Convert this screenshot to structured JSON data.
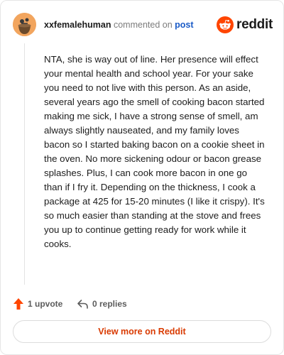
{
  "comment": {
    "username": "xxfemalehuman",
    "commented_text": "commented on",
    "post_link_text": "post",
    "body": "NTA, she is way out of line. Her presence will effect your mental health and school year. For your sake you need to not live with this person. As an aside, several years ago the smell of cooking bacon started making me sick, I have a strong sense of smell, am always slightly nauseated, and my family loves bacon so I started baking bacon on a cookie sheet in the oven. No more sickening odour or bacon grease splashes. Plus, I can cook more bacon in one go than if I fry it. Depending on the thickness, I cook a package at 425 for 15-20 minutes (I like it crispy). It's so much easier than standing at the stove and frees you up to continue getting ready for work while it cooks."
  },
  "brand": {
    "name": "reddit",
    "logo_icon": "reddit-snoo-icon",
    "accent_color": "#ff4500"
  },
  "actions": {
    "upvote_label": "1 upvote",
    "upvote_icon": "upvote-arrow-icon",
    "replies_label": "0 replies",
    "replies_icon": "reply-arrow-icon"
  },
  "footer": {
    "view_more_label": "View more on Reddit",
    "view_more_color": "#d93a00"
  }
}
